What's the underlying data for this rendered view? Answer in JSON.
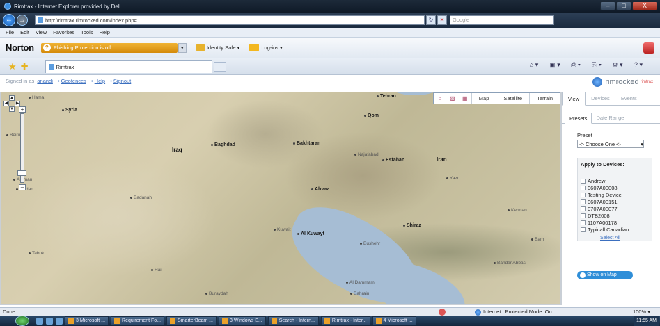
{
  "window": {
    "title": "Rimtrax - Internet Explorer provided by Dell",
    "buttons": [
      "–",
      "□",
      "X"
    ]
  },
  "nav": {
    "back_icon": "←",
    "forward_icon": "→",
    "url": "http://rimtrax.rimrocked.com/index.php#",
    "refresh_icon": "↻",
    "stop_icon": "✕",
    "search_placeholder": "Google"
  },
  "menu": [
    "File",
    "Edit",
    "View",
    "Favorites",
    "Tools",
    "Help"
  ],
  "norton": {
    "brand": "Norton",
    "phishing_text": "Phishing Protection is off",
    "phishing_icon": "?",
    "identity_safe": "Identity Safe ▾",
    "logins": "Log-ins ▾",
    "dropdown_glyph": "▾"
  },
  "favorites": {
    "tab_title": "Rimtrax",
    "command_icons": [
      "⌂ ▾",
      "▣ ▾",
      "⎙ ▾",
      "⎘ ▾",
      "⚙ ▾",
      "? ▾"
    ]
  },
  "page": {
    "signed_in_prefix": "Signed in as",
    "username": "anandi",
    "links": [
      "Geofences",
      "Help",
      "Signout"
    ],
    "brand_name": "rimrocked",
    "brand_sup": "rimtrax"
  },
  "map": {
    "type_buttons": [
      "Map",
      "Satellite",
      "Terrain"
    ],
    "mode_icons": [
      "⌂",
      "▧",
      "▦"
    ],
    "pan_glyphs": {
      "up": "▲",
      "left": "◀",
      "right": "▶",
      "down": "▼"
    },
    "zoom_in": "+",
    "zoom_out": "–",
    "labels": [
      {
        "text": "Syria",
        "cls": "med"
      },
      {
        "text": "Iraq",
        "cls": "big"
      },
      {
        "text": "Baghdad",
        "cls": "med"
      },
      {
        "text": "Bakhtaran",
        "cls": "med"
      },
      {
        "text": "Qom",
        "cls": "med"
      },
      {
        "text": "Tehran",
        "cls": "med"
      },
      {
        "text": "Iran",
        "cls": "big"
      },
      {
        "text": "Esfahan",
        "cls": "med"
      },
      {
        "text": "Najafabad",
        "cls": "light"
      },
      {
        "text": "Yazd",
        "cls": "light"
      },
      {
        "text": "Ahvaz",
        "cls": "med"
      },
      {
        "text": "Kuwait",
        "cls": "light"
      },
      {
        "text": "Al Kuwayt",
        "cls": "med"
      },
      {
        "text": "Shiraz",
        "cls": "med"
      },
      {
        "text": "Bushehr",
        "cls": "light"
      },
      {
        "text": "Kerman",
        "cls": "light"
      },
      {
        "text": "Bam",
        "cls": "light"
      },
      {
        "text": "Bandar Abbas",
        "cls": "light"
      },
      {
        "text": "Al Dammam",
        "cls": "light"
      },
      {
        "text": "Bahrain",
        "cls": "light"
      },
      {
        "text": "Buraydah",
        "cls": "light"
      },
      {
        "text": "Hail",
        "cls": "light"
      },
      {
        "text": "Tabuk",
        "cls": "light"
      },
      {
        "text": "Badanah",
        "cls": "light"
      },
      {
        "text": "Amman",
        "cls": "light"
      },
      {
        "text": "Jordan",
        "cls": "light"
      },
      {
        "text": "Beirut",
        "cls": "light"
      },
      {
        "text": "Hama",
        "cls": "light"
      }
    ]
  },
  "panel": {
    "tabs": [
      "View",
      "Devices",
      "Events"
    ],
    "subtabs": [
      "Presets",
      "Date Range"
    ],
    "preset_label": "Preset",
    "preset_value": "-> Choose One <-",
    "apply_header": "Apply to Devices:",
    "devices": [
      "Andrew",
      "0607A00008",
      "Testing Device",
      "0607A00151",
      "0707A00077",
      "DTB2008",
      "1107A00178",
      "Typicall Canadian"
    ],
    "select_all": "Select All",
    "show_on_map": "Show on Map"
  },
  "status": {
    "text": "Done",
    "zone": "Internet | Protected Mode: On",
    "zoom": "100%  ▾"
  },
  "taskbar": {
    "items": [
      "3 Microsoft ...",
      "Requirement Fo...",
      "SmarterBeam ...",
      "3 Windows E...",
      "Search - Intern...",
      "Rimtrax - Inter...",
      "4 Microsoft ..."
    ],
    "clock": "11:55 AM"
  }
}
